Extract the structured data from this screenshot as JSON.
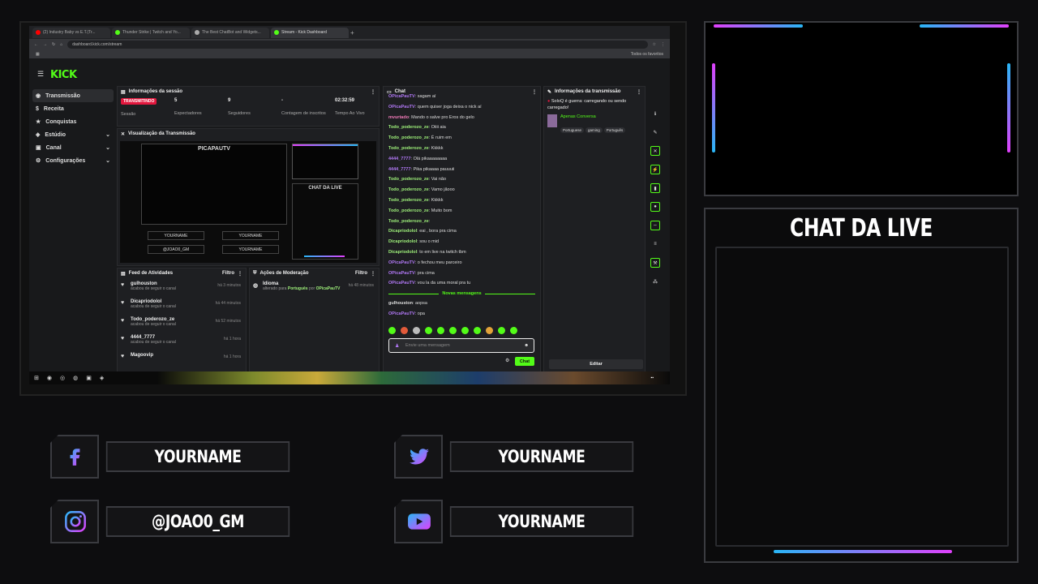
{
  "browser": {
    "tabs": [
      {
        "label": "(2) Industry Baby vs E.T.(Tr...",
        "color": "#ff0000"
      },
      {
        "label": "Thunder Strike | Twitch and Yo...",
        "color": "#53fc18"
      },
      {
        "label": "The Best ChatBot and Widgets...",
        "color": "#aaaaaa"
      },
      {
        "label": "Stream - Kick Dashboard",
        "color": "#53fc18"
      }
    ],
    "url": "dashboard.kick.com/stream",
    "bookmarks_right": "Todos os favoritos"
  },
  "kick": {
    "logo": "KICK",
    "sidebar": [
      {
        "label": "Transmissão",
        "active": true,
        "chev": ""
      },
      {
        "label": "Receita",
        "active": false,
        "chev": ""
      },
      {
        "label": "Conquistas",
        "active": false,
        "chev": ""
      },
      {
        "label": "Estúdio",
        "active": false,
        "chev": "⌄"
      },
      {
        "label": "Canal",
        "active": false,
        "chev": "⌄"
      },
      {
        "label": "Configurações",
        "active": false,
        "chev": "⌄"
      }
    ],
    "session": {
      "title": "Informações da sessão",
      "status": "TRANSMITINDO",
      "status_label": "Sessão",
      "viewers": "5",
      "viewers_label": "Espectadores",
      "followers": "9",
      "followers_label": "Seguidores",
      "subs": "-",
      "subs_label": "Contagem de inscritos",
      "uptime": "02:32:59",
      "uptime_label": "Tempo Ao Vivo"
    },
    "preview": {
      "title": "Visualização da Transmissão",
      "name": "PICAPAUTV",
      "chat_label": "CHAT DA LIVE",
      "socials": [
        "YOURNAME",
        "YOURNAME",
        "@JOAO0_GM",
        "YOURNAME"
      ]
    },
    "activity": {
      "title": "Feed de Atividades",
      "filter": "Filtro",
      "items": [
        {
          "user": "gulhouston",
          "action": "acabou de seguir o canal",
          "time": "há 3 minutos"
        },
        {
          "user": "Dicapriodolol",
          "action": "acabou de seguir o canal",
          "time": "há 44 minutos"
        },
        {
          "user": "Todo_poderozo_ze",
          "action": "acabou de seguir o canal",
          "time": "há 52 minutos"
        },
        {
          "user": "4444_7777",
          "action": "acabou de seguir o canal",
          "time": "há 1 hora"
        },
        {
          "user": "Magoovip",
          "action": "",
          "time": "há 1 hora"
        }
      ]
    },
    "moderation": {
      "title": "Ações de Moderação",
      "filter": "Filtro",
      "user": "Idioma",
      "detail_prefix": "alterado para",
      "detail_lang": "Português",
      "detail_by": "por",
      "detail_mod": "OPicaPauTV",
      "time": "há 48 minutos"
    },
    "chat": {
      "title": "Chat",
      "lines": [
        {
          "user": "OPicaPauTV",
          "msg": "sagam aí",
          "cls": "u-p"
        },
        {
          "user": "OPicaPauTV",
          "msg": "quem quiser joga deixa o nick aí",
          "cls": "u-p"
        },
        {
          "user": "mvurtado",
          "msg": "Mando o salve pro Eros do gelo",
          "cls": "u-pk"
        },
        {
          "user": "Todo_poderozo_ze",
          "msg": "Oiiii aia",
          "cls": "u-g"
        },
        {
          "user": "Todo_poderozo_ze",
          "msg": "É ruim em",
          "cls": "u-g"
        },
        {
          "user": "Todo_poderozo_ze",
          "msg": "Kkkkk",
          "cls": "u-g"
        },
        {
          "user": "4444_7777",
          "msg": "Olá pikaaaaaaaa",
          "cls": "u-p"
        },
        {
          "user": "4444_7777",
          "msg": "Pika pikaaaa pauuuii",
          "cls": "u-p"
        },
        {
          "user": "Todo_poderozo_ze",
          "msg": "Vai não",
          "cls": "u-g"
        },
        {
          "user": "Todo_poderozo_ze",
          "msg": "Vamo jãooo",
          "cls": "u-g"
        },
        {
          "user": "Todo_poderozo_ze",
          "msg": "Kkkkk",
          "cls": "u-g"
        },
        {
          "user": "Todo_poderozo_ze",
          "msg": "Muito bom",
          "cls": "u-g"
        },
        {
          "user": "Todo_poderozo_ze",
          "msg": "",
          "cls": "u-g"
        },
        {
          "user": "Dicapriodolol",
          "msg": "eai , bora pra cima",
          "cls": "u-g"
        },
        {
          "user": "Dicapriodolol",
          "msg": "sou o mid",
          "cls": "u-g"
        },
        {
          "user": "Dicapriodolol",
          "msg": "to em live na twitch tbm",
          "cls": "u-g"
        },
        {
          "user": "OPicaPauTV",
          "msg": "o fechou meu parceiro",
          "cls": "u-p"
        },
        {
          "user": "OPicaPauTV",
          "msg": "pra cima",
          "cls": "u-p"
        },
        {
          "user": "OPicaPauTV",
          "msg": "vou la da uma moral pra tu",
          "cls": "u-p"
        }
      ],
      "new_messages": "Novas mensagens",
      "after": [
        {
          "user": "gulhouston",
          "msg": "aopsa",
          "cls": "u-w"
        },
        {
          "user": "OPicaPauTV",
          "msg": "opa",
          "cls": "u-p"
        }
      ],
      "placeholder": "Envie uma mensagem",
      "send": "Chat"
    },
    "stream_info": {
      "title": "Informações da transmissão",
      "stream_title": "SoloQ é guerra: carregando ou sendo carregado!",
      "category": "Apenas Conversa",
      "tags": [
        "Portuguese",
        "gaming",
        "Português"
      ],
      "edit": "Editar"
    }
  },
  "overlay": {
    "chat_title": "CHAT DA LIVE",
    "socials": [
      {
        "name": "YOURNAME",
        "icon": "facebook-icon"
      },
      {
        "name": "YOURNAME",
        "icon": "twitter-icon"
      },
      {
        "name": "@JOAO0_GM",
        "icon": "instagram-icon"
      },
      {
        "name": "YOURNAME",
        "icon": "youtube-icon"
      }
    ],
    "accent_pink": "#e040fb",
    "accent_cyan": "#29b6f6"
  }
}
